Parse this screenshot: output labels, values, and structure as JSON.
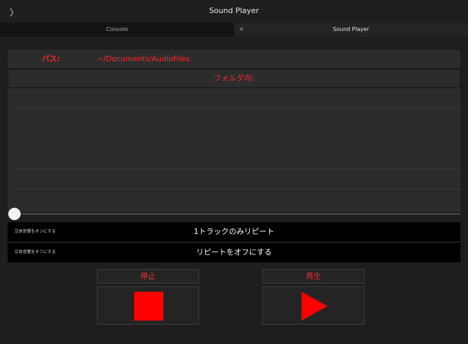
{
  "title_bar": {
    "back_glyph": "〉",
    "title": "Sound Player"
  },
  "tabs": [
    {
      "label": "Console",
      "active": false
    },
    {
      "label": "Sound Player",
      "active": true,
      "close_glyph": "×"
    }
  ],
  "path": {
    "label": "パス:",
    "value": "~/Documents/AudioFiles"
  },
  "folder": {
    "header": "フォルダ内:"
  },
  "slider": {
    "position_fraction": 0.0
  },
  "options": [
    {
      "small_label": "立体音響をオンにする",
      "main_label": "1トラックのみリピート"
    },
    {
      "small_label": "立体音響をオフにする",
      "main_label": "リピートをオフにする"
    }
  ],
  "controls": {
    "stop_label": "停止",
    "play_label": "再生",
    "stop_icon": "stop-square-icon",
    "play_icon": "play-triangle-icon"
  },
  "colors": {
    "accent": "#ff2828",
    "background": "#1e1e1e",
    "panel": "#2c2c2c"
  }
}
